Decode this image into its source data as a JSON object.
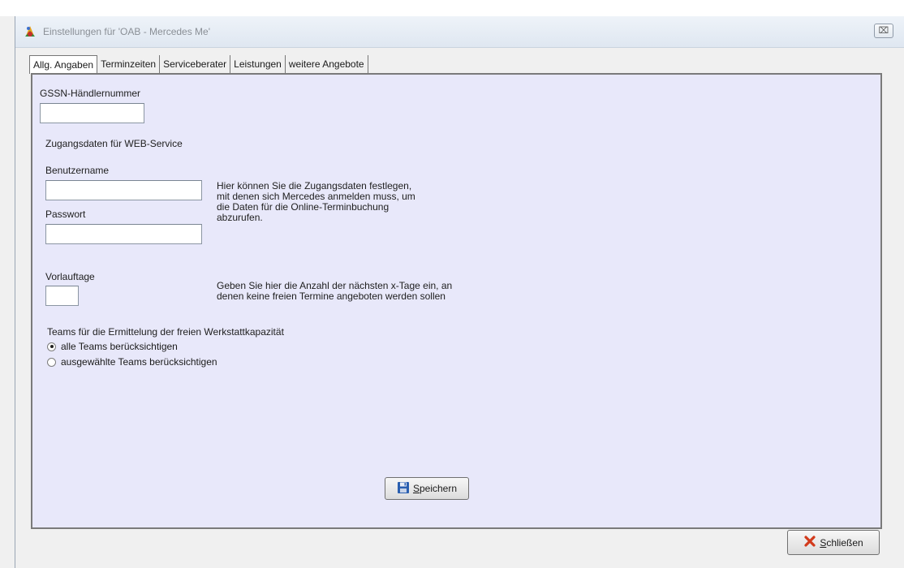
{
  "window": {
    "title": "Einstellungen für 'OAB - Mercedes Me'",
    "close_glyph": "⌧"
  },
  "tabs": [
    {
      "label": "Allg. Angaben",
      "active": true
    },
    {
      "label": "Terminzeiten",
      "active": false
    },
    {
      "label": "Serviceberater",
      "active": false
    },
    {
      "label": "Leistungen",
      "active": false
    },
    {
      "label": "weitere Angebote",
      "active": false
    }
  ],
  "form": {
    "gssn_label": "GSSN-Händlernummer",
    "gssn_value": "",
    "webservice_heading": "Zugangsdaten für WEB-Service",
    "username_label": "Benutzername",
    "username_value": "",
    "password_label": "Passwort",
    "password_value": "",
    "access_help": [
      "Hier können Sie die Zugangsdaten festlegen,",
      "mit denen sich Mercedes anmelden muss, um",
      "die Daten für die Online-Terminbuchung",
      "abzurufen."
    ],
    "lead_days_label": "Vorlauftage",
    "lead_days_value": "",
    "lead_days_help": [
      "Geben Sie hier die Anzahl der nächsten x-Tage ein, an",
      "denen keine freien Termine angeboten werden sollen"
    ],
    "teams_heading": "Teams für die Ermittelung der freien Werkstattkapazität",
    "team_options": [
      {
        "label": "alle Teams berücksichtigen",
        "checked": true
      },
      {
        "label": "ausgewählte Teams berücksichtigen",
        "checked": false
      }
    ],
    "save_label": "Speichern"
  },
  "footer": {
    "close_label": "Schließen"
  },
  "icons": {
    "app": "app-logo-icon",
    "save": "floppy-disk-icon",
    "close": "red-x-icon"
  },
  "colors": {
    "panel_background": "#e8e8fa",
    "save_icon": "#2a5fb0",
    "close_icon": "#d23a1c"
  }
}
